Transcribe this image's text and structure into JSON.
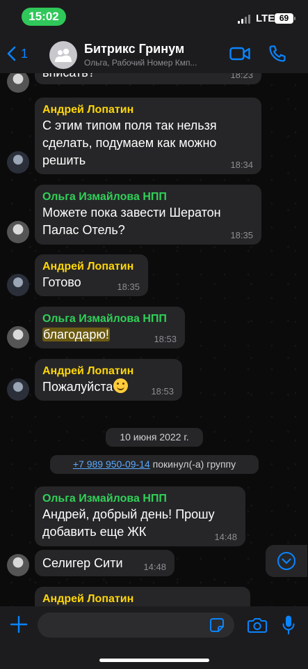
{
  "status_bar": {
    "time": "15:02",
    "network": "LTE",
    "battery": "69"
  },
  "header": {
    "back_count": "1",
    "title": "Битрикс Гринум",
    "subtitle": "Ольга, Рабочий Номер Кмп...",
    "back_icon": "chevron-left-icon",
    "video_icon": "video-camera-icon",
    "call_icon": "phone-icon"
  },
  "messages": [
    {
      "sender": "",
      "text": "вписать?",
      "time": "18:23"
    },
    {
      "sender": "Андрей Лопатин",
      "text": "С этим типом поля так нельзя сделать, подумаем как можно решить",
      "time": "18:34"
    },
    {
      "sender": "Ольга Измайлова НПП",
      "text": "Можете пока завести Шератон Палас Отель?",
      "time": "18:35"
    },
    {
      "sender": "Андрей Лопатин",
      "text": "Готово",
      "time": "18:35"
    },
    {
      "sender": "Ольга Измайлова НПП",
      "text": "благодарю!",
      "time": "18:53"
    },
    {
      "sender": "Андрей Лопатин",
      "text": "Пожалуйста",
      "emoji": "smiling-face-emoji",
      "time": "18:53"
    },
    {
      "sender": "Ольга Измайлова НПП",
      "text": "Андрей, добрый день! Прошу добавить еще ЖК",
      "time": "14:48"
    },
    {
      "sender": "",
      "text": "Селигер Сити",
      "time": "14:48"
    },
    {
      "sender": "Андрей Лопатин",
      "text": "",
      "time": ""
    }
  ],
  "date_separator": "10 июня 2022 г.",
  "system_message": {
    "phone": "+7 989 950-09-14",
    "action": " покинул(-а) группу"
  },
  "colors": {
    "sender_yellow": "#ffd60a",
    "sender_green": "#30d158",
    "accent_blue": "#0a84ff",
    "bubble": "#262628"
  },
  "input": {
    "placeholder": "",
    "value": ""
  },
  "icons": {
    "plus": "plus-icon",
    "sticker": "sticker-icon",
    "camera": "camera-icon",
    "mic": "microphone-icon",
    "scroll": "chevron-down-circle-icon"
  }
}
